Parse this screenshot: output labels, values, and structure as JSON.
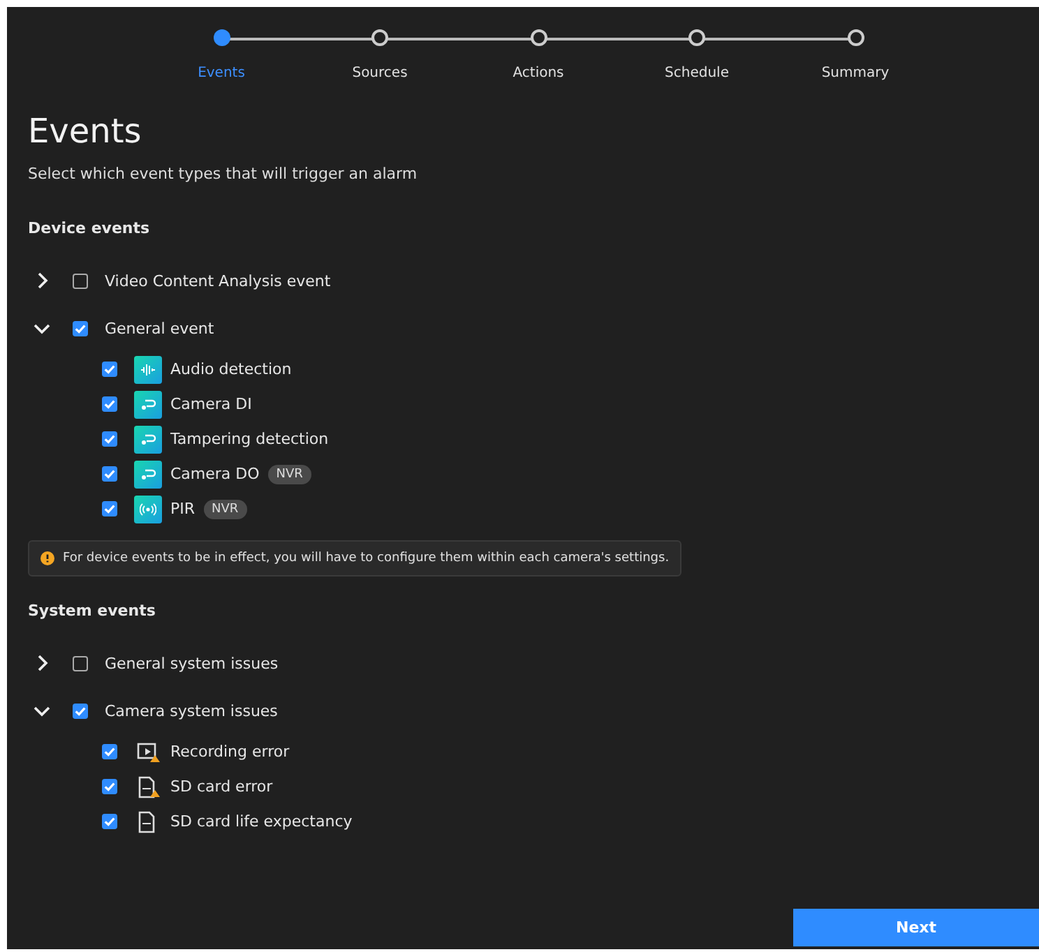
{
  "steps": [
    {
      "label": "Events",
      "selected": true
    },
    {
      "label": "Sources",
      "selected": false
    },
    {
      "label": "Actions",
      "selected": false
    },
    {
      "label": "Schedule",
      "selected": false
    },
    {
      "label": "Summary",
      "selected": false
    }
  ],
  "title": "Events",
  "subtitle": "Select which event types that will trigger an alarm",
  "sections": [
    {
      "heading": "Device events",
      "groups": [
        {
          "label": "Video Content Analysis event",
          "checked": false,
          "expanded": false
        },
        {
          "label": "General event",
          "checked": true,
          "expanded": true,
          "children": [
            {
              "label": "Audio detection",
              "checked": true,
              "kind": "audio"
            },
            {
              "label": "Camera DI",
              "checked": true,
              "kind": "link"
            },
            {
              "label": "Tampering detection",
              "checked": true,
              "kind": "link"
            },
            {
              "label": "Camera DO",
              "checked": true,
              "kind": "link",
              "badge": "NVR"
            },
            {
              "label": "PIR",
              "checked": true,
              "kind": "pir",
              "badge": "NVR"
            }
          ]
        }
      ],
      "notice": "For device events to be in effect, you will have to configure them within each camera's settings."
    },
    {
      "heading": "System events",
      "groups": [
        {
          "label": "General system issues",
          "checked": false,
          "expanded": false
        },
        {
          "label": "Camera system issues",
          "checked": true,
          "expanded": true,
          "children": [
            {
              "label": "Recording error",
              "checked": true,
              "kind": "recording"
            },
            {
              "label": "SD card error",
              "checked": true,
              "kind": "sd-error"
            },
            {
              "label": "SD card life expectancy",
              "checked": true,
              "kind": "sd"
            }
          ]
        }
      ]
    }
  ],
  "next_button": "Next"
}
